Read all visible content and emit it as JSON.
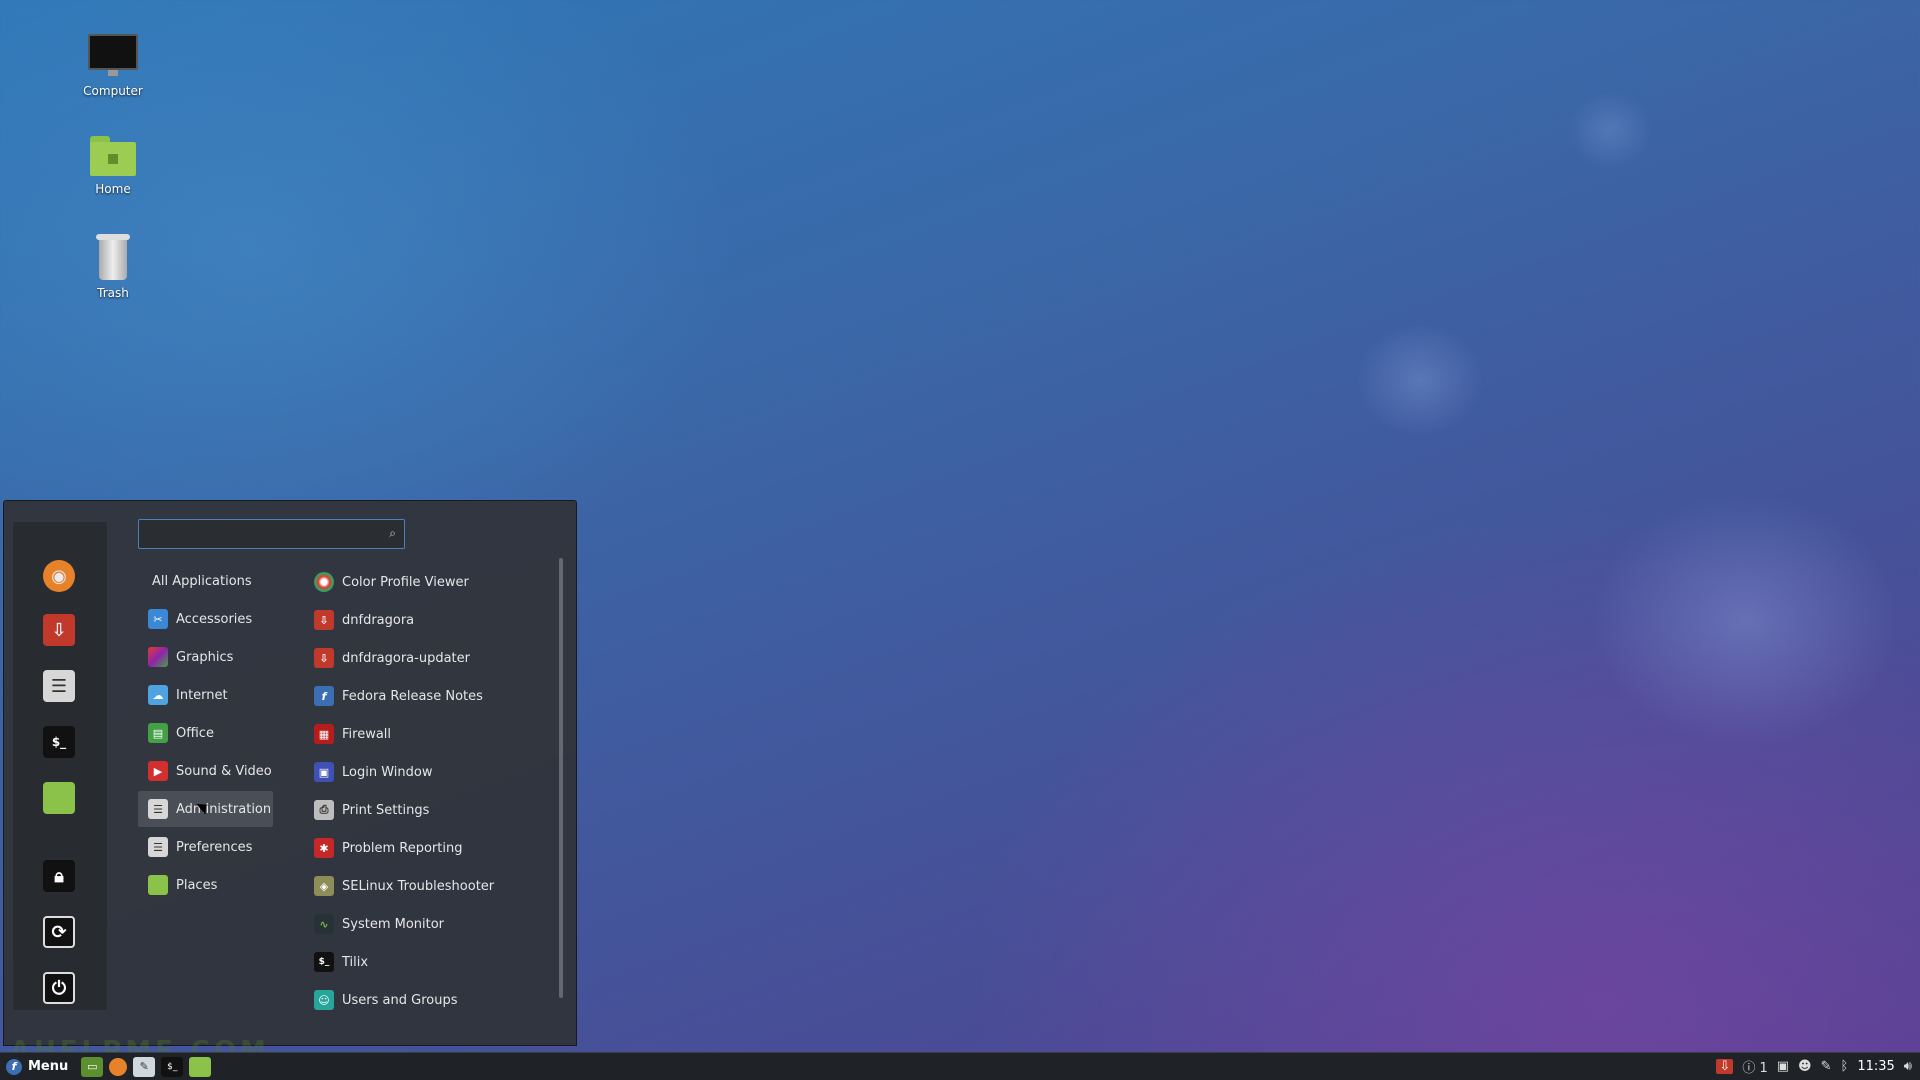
{
  "desktop": {
    "icons": [
      {
        "label": "Computer",
        "icon": "computer-icon"
      },
      {
        "label": "Home",
        "icon": "home-folder-icon"
      },
      {
        "label": "Trash",
        "icon": "trash-icon"
      }
    ]
  },
  "menu": {
    "search": {
      "value": "",
      "placeholder": ""
    },
    "favorites": [
      {
        "name": "firefox-icon"
      },
      {
        "name": "software-update-icon"
      },
      {
        "name": "settings-icon"
      },
      {
        "name": "terminal-icon"
      },
      {
        "name": "files-icon"
      },
      {
        "name": "lock-screen-icon"
      },
      {
        "name": "logout-icon"
      },
      {
        "name": "power-icon"
      }
    ],
    "categories": [
      {
        "label": "All Applications"
      },
      {
        "label": "Accessories"
      },
      {
        "label": "Graphics"
      },
      {
        "label": "Internet"
      },
      {
        "label": "Office"
      },
      {
        "label": "Sound & Video"
      },
      {
        "label": "Administration"
      },
      {
        "label": "Preferences"
      },
      {
        "label": "Places"
      }
    ],
    "active_category": "Administration",
    "apps": [
      {
        "label": "Color Profile Viewer"
      },
      {
        "label": "dnfdragora"
      },
      {
        "label": "dnfdragora-updater"
      },
      {
        "label": "Fedora Release Notes"
      },
      {
        "label": "Firewall"
      },
      {
        "label": "Login Window"
      },
      {
        "label": "Print Settings"
      },
      {
        "label": "Problem Reporting"
      },
      {
        "label": "SELinux Troubleshooter"
      },
      {
        "label": "System Monitor"
      },
      {
        "label": "Tilix"
      },
      {
        "label": "Users and Groups"
      }
    ]
  },
  "taskbar": {
    "menu_label": "Menu",
    "notification_count": "1",
    "clock": "11:35"
  },
  "watermark": "AHELPME.COM"
}
